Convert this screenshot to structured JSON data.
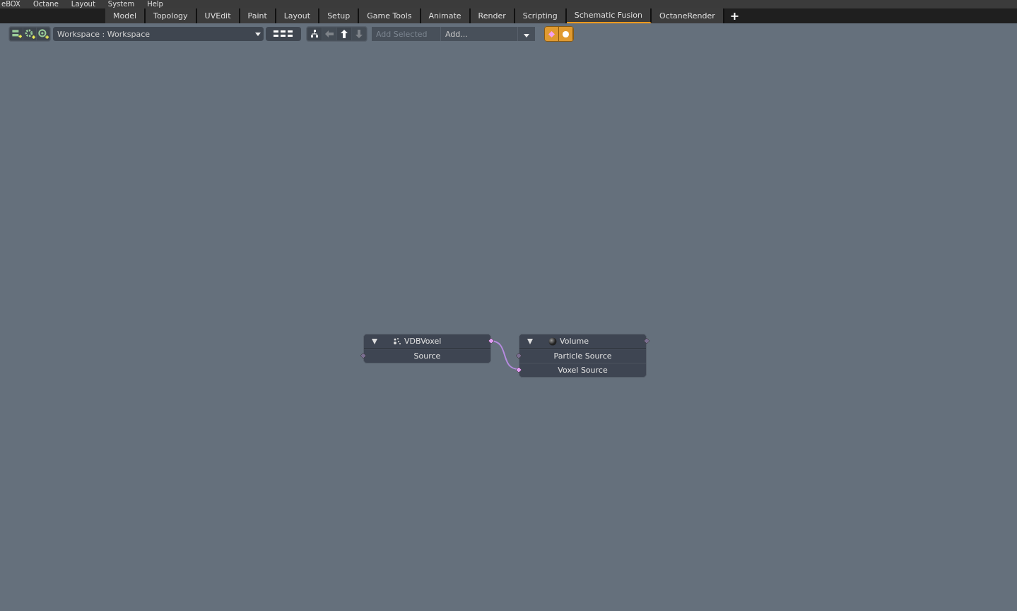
{
  "menu_bar": {
    "items": [
      "eBOX",
      "Octane",
      "Layout",
      "System",
      "Help"
    ]
  },
  "tabs": [
    {
      "label": "Model",
      "selected": false
    },
    {
      "label": "Topology",
      "selected": false
    },
    {
      "label": "UVEdit",
      "selected": false
    },
    {
      "label": "Paint",
      "selected": false
    },
    {
      "label": "Layout",
      "selected": false
    },
    {
      "label": "Setup",
      "selected": false
    },
    {
      "label": "Game Tools",
      "selected": false
    },
    {
      "label": "Animate",
      "selected": false
    },
    {
      "label": "Render",
      "selected": false
    },
    {
      "label": "Scripting",
      "selected": false
    },
    {
      "label": "Schematic Fusion",
      "selected": true
    },
    {
      "label": "OctaneRender",
      "selected": false
    }
  ],
  "add_tab_button": "+",
  "toolbar": {
    "workspace": "Workspace : Workspace",
    "nav_buttons": [
      {
        "kind": "tree",
        "disabled": false
      },
      {
        "kind": "left",
        "disabled": true
      },
      {
        "kind": "up",
        "disabled": false
      },
      {
        "kind": "down",
        "disabled": true
      }
    ],
    "add_selected": {
      "label": "Add Selected",
      "disabled": true
    },
    "add": {
      "placeholder": "Add..."
    }
  },
  "nodes": [
    {
      "title": "VDBVoxel",
      "kind": "particles",
      "output_connected": true,
      "rows": [
        {
          "label": "Source",
          "input_connected": false
        }
      ]
    },
    {
      "title": "Volume",
      "kind": "sphere",
      "output_connected": false,
      "rows": [
        {
          "label": "Particle Source",
          "input_connected": false
        },
        {
          "label": "Voxel Source",
          "input_connected": true
        }
      ]
    }
  ]
}
